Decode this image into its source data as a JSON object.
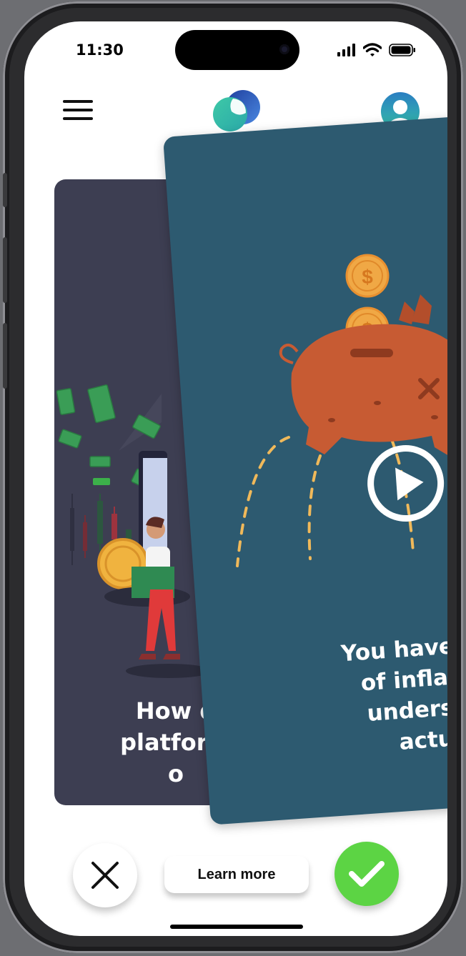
{
  "status_bar": {
    "time": "11:30"
  },
  "header": {
    "menu_icon": "hamburger-menu-icon",
    "logo_icon": "app-logo-icon",
    "profile_icon": "user-avatar-icon"
  },
  "cards": {
    "back": {
      "caption_line1": "How d",
      "caption_line2": "platform",
      "caption_line3": "o"
    },
    "front": {
      "caption_line1": "You have probably",
      "caption_line2": "of inflation. But",
      "caption_line3": "understand wh",
      "caption_line4": "actually is",
      "video_icon": "play-icon"
    }
  },
  "actions": {
    "reject_icon": "close-icon",
    "learn_more_label": "Learn more",
    "accept_icon": "checkmark-icon"
  },
  "colors": {
    "back_card": "#3d3e52",
    "front_card": "#2d5a70",
    "accept": "#5cd444",
    "coin": "#f0a845",
    "piggy": "#c75b33"
  }
}
